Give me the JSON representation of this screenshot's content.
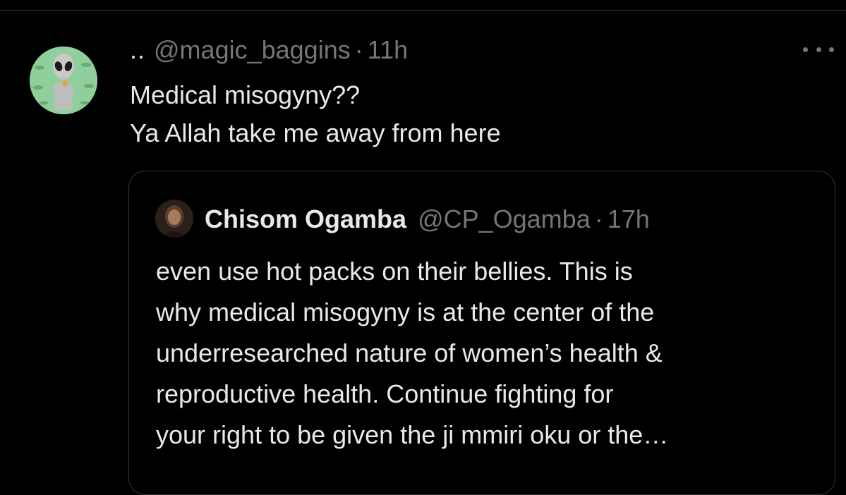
{
  "tweet": {
    "display_name": "..",
    "handle": "@magic_baggins",
    "separator": "·",
    "time": "11h",
    "more_icon": "more-horizontal-icon",
    "avatar": "alien-avatar",
    "text_lines": [
      "Medical misogyny??",
      "Ya Allah take me away from here"
    ]
  },
  "quote": {
    "display_name": "Chisom Ogamba",
    "handle": "@CP_Ogamba",
    "separator": "·",
    "time": "17h",
    "avatar": "profile-photo",
    "text_lines": [
      "even use hot packs on their bellies. This is",
      "why medical misogyny is at the center of the",
      "underresearched nature of women’s health &",
      "reproductive health. Continue fighting for",
      "your right to be given the ji mmiri oku or the…"
    ]
  },
  "colors": {
    "background": "#000000",
    "primary_text": "#e7e9ea",
    "secondary_text": "#71767b",
    "border": "#2f3336",
    "avatar_bg": "#8fcf9b"
  }
}
